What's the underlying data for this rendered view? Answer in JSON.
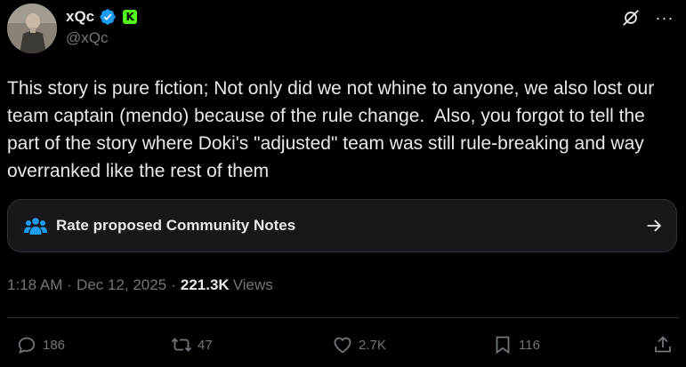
{
  "author": {
    "display_name": "xQc",
    "handle": "@xQc",
    "verified_icon": "verified-badge-icon",
    "affiliate_badge": "K"
  },
  "header": {
    "grok_icon": "grok-icon",
    "more_icon": "more-icon",
    "more_label": "···"
  },
  "tweet": {
    "text": "This story is pure fiction; Not only did we not whine to anyone, we also lost our team captain (mendo) because of the rule change.  Also, you forgot to tell the part of the story where Doki's \"adjusted\" team was still rule-breaking and way overranked like the rest of them"
  },
  "community_notes": {
    "label": "Rate proposed Community Notes",
    "icon": "community-notes-icon",
    "arrow_icon": "arrow-right-icon"
  },
  "meta": {
    "time": "1:18 AM",
    "separator": "·",
    "date": "Dec 12, 2025",
    "views_count": "221.3K",
    "views_label": "Views"
  },
  "actions": {
    "replies": "186",
    "reposts": "47",
    "likes": "2.7K",
    "bookmarks": "116"
  },
  "colors": {
    "background": "#000000",
    "text": "#e7e9ea",
    "secondary": "#71767b",
    "accent": "#1d9bf0",
    "kick_green": "#53fc18"
  }
}
